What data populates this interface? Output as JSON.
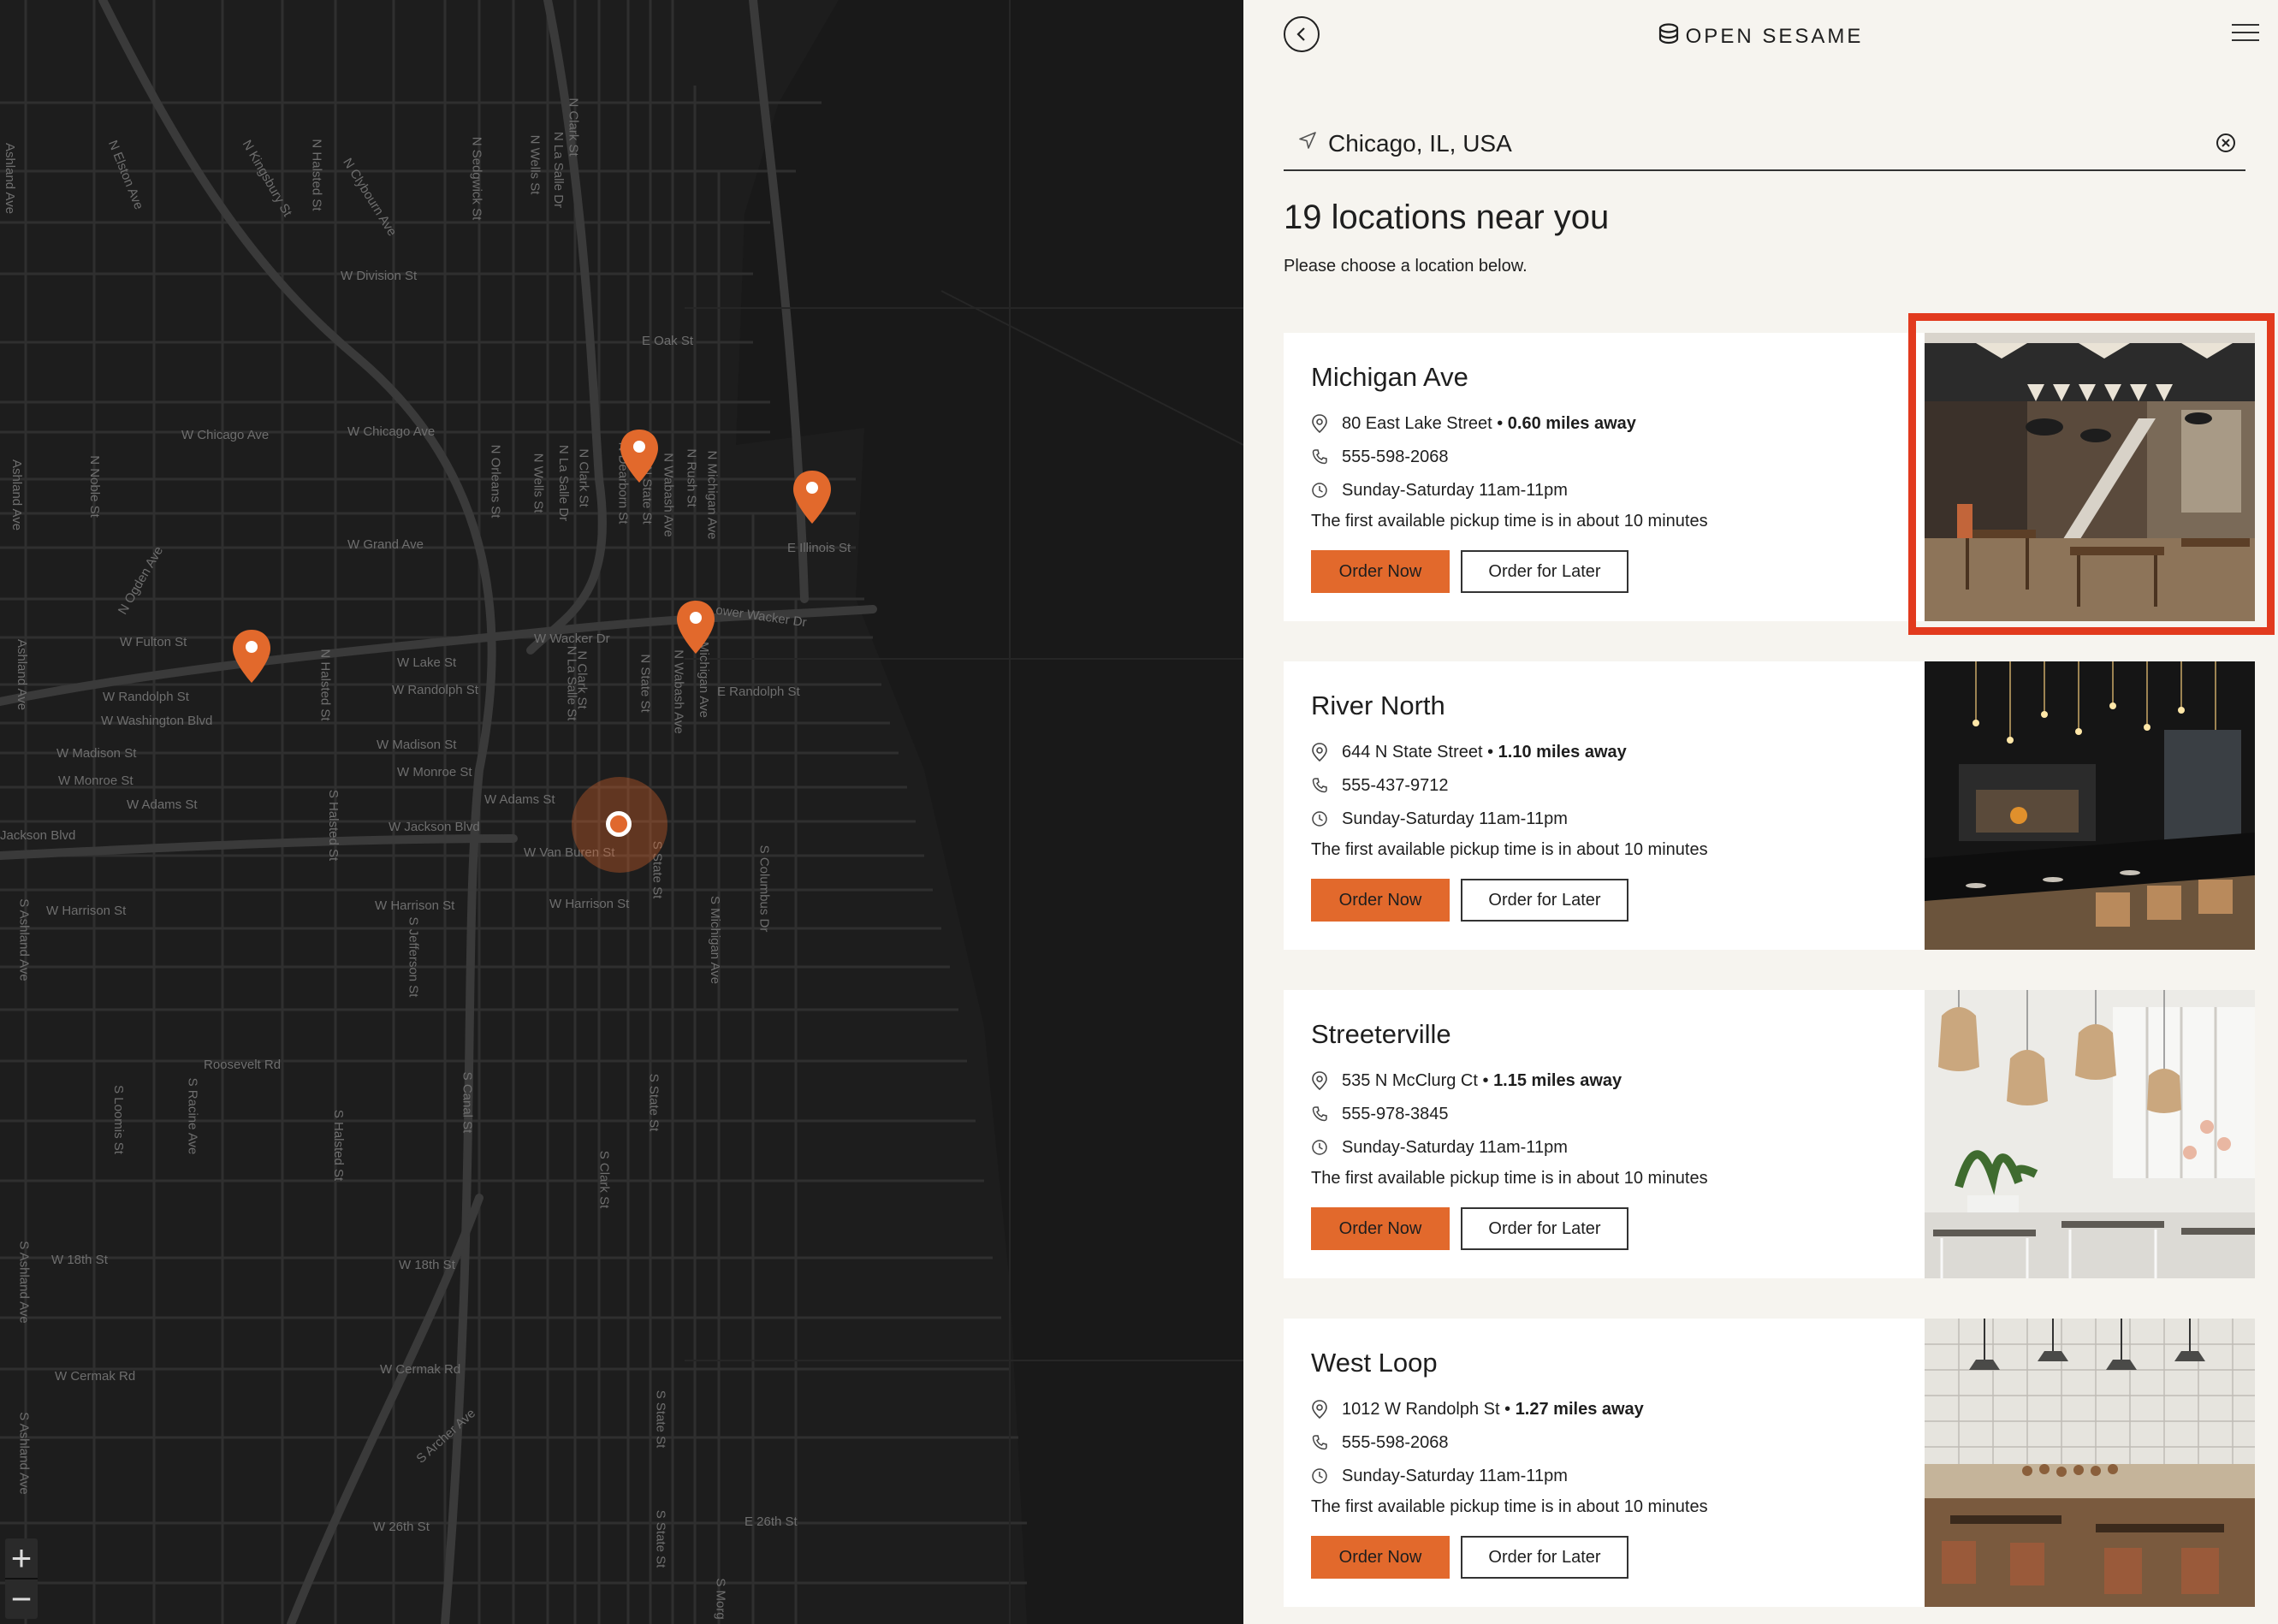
{
  "brand": {
    "name": "OPEN SESAME"
  },
  "search": {
    "value": "Chicago, IL, USA"
  },
  "results": {
    "heading": "19 locations near you",
    "subheading": "Please choose a location below."
  },
  "locations": [
    {
      "name": "Michigan Ave",
      "address": "80 East Lake Street",
      "distance": "0.60 miles away",
      "phone": "555-598-2068",
      "hours": "Sunday-Saturday 11am-11pm",
      "pickup": "The first available pickup time is in about 10 minutes",
      "order_now": "Order Now",
      "order_later": "Order for Later"
    },
    {
      "name": "River North",
      "address": "644 N State Street",
      "distance": "1.10 miles away",
      "phone": "555-437-9712",
      "hours": "Sunday-Saturday 11am-11pm",
      "pickup": "The first available pickup time is in about 10 minutes",
      "order_now": "Order Now",
      "order_later": "Order for Later"
    },
    {
      "name": "Streeterville",
      "address": "535 N McClurg Ct",
      "distance": "1.15 miles away",
      "phone": "555-978-3845",
      "hours": "Sunday-Saturday 11am-11pm",
      "pickup": "The first available pickup time is in about 10 minutes",
      "order_now": "Order Now",
      "order_later": "Order for Later"
    },
    {
      "name": "West Loop",
      "address": "1012 W Randolph St",
      "distance": "1.27 miles away",
      "phone": "555-598-2068",
      "hours": "Sunday-Saturday 11am-11pm",
      "pickup": "The first available pickup time is in about 10 minutes",
      "order_now": "Order Now",
      "order_later": "Order for Later"
    }
  ],
  "map": {
    "streets": {
      "division": "W Division St",
      "oak": "E Oak St",
      "chicago1": "W Chicago Ave",
      "chicago2": "W Chicago Ave",
      "grand": "W Grand Ave",
      "illinois": "E Illinois St",
      "fulton": "W Fulton St",
      "lake": "W Lake St",
      "randolph1": "W Randolph St",
      "randolph2": "W Randolph St",
      "washington": "W Washington Blvd",
      "madison1": "W Madison St",
      "madison2": "W Madison St",
      "monroe1": "W Monroe St",
      "monroe2": "W Monroe St",
      "adams1": "W Adams St",
      "adams2": "W Adams St",
      "jackson1": "Jackson Blvd",
      "jackson2": "W Jackson Blvd",
      "vanburen": "W Van Buren St",
      "harrison1": "W Harrison St",
      "harrison2": "W Harrison St",
      "harrison3": "W Harrison St",
      "wacker": "W Wacker Dr",
      "lowerwacker": "ower Wacker Dr",
      "erandolph": "E Randolph St",
      "roosevelt": "Roosevelt Rd",
      "18th1": "W 18th St",
      "18th2": "W 18th St",
      "cermak1": "W Cermak Rd",
      "cermak2": "W Cermak Rd",
      "26th1": "W 26th St",
      "26th2": "E 26th St",
      "archer": "S Archer Ave",
      "ashland1": "Ashland Ave",
      "ashland2": "Ashland Ave",
      "ashland3": "Ashland Ave",
      "ashland4": "S Ashland Ave",
      "ashland5": "S Ashland Ave",
      "ashland6": "S Ashland Ave",
      "noble": "N Noble St",
      "ogden": "N Ogden Ave",
      "elston": "N Elston Ave",
      "kingsbury": "N Kingsbury St",
      "halsted1": "N Halsted St",
      "halsted2": "N Halsted St",
      "halsted3": "S Halsted St",
      "halsted4": "S Halsted St",
      "clybourn": "N Clybourn Ave",
      "sedgwick": "N Sedgwick St",
      "orleans": "N Orleans St",
      "wells1": "N Wells St",
      "wells2": "N Wells St",
      "lasalle1": "N La Salle Dr",
      "lasalle2": "N La Salle Dr",
      "lasalle3": "N La Salle St",
      "clark1": "N Clark St",
      "clark2": "N Clark St",
      "clark3": "N Clark St",
      "clark4": "S Clark St",
      "dearborn": "N Dearborn St",
      "state1": "N State St",
      "state2": "S State St",
      "state3": "S State St",
      "state4": "S State St",
      "state5": "S State St",
      "wabash1": "N Wabash Ave",
      "wabash2": "N Wabash Ave",
      "rush": "N Rush St",
      "michigan1": "N Michigan Ave",
      "michigan2": "Michigan Ave",
      "michigan3": "S Michigan Ave",
      "columbus": "S Columbus Dr",
      "jefferson": "S Jefferson St",
      "canal": "S Canal St",
      "loomis": "S Loomis St",
      "racine": "S Racine Ave",
      "morgan": "S Morg",
      "statesouth": "S State St"
    },
    "zoom_in": "+",
    "zoom_out": "−"
  },
  "colors": {
    "accent": "#e2692c",
    "panel_bg": "#f6f4ef",
    "map_bg": "#1d1d1d",
    "highlight": "#e23a1e"
  }
}
